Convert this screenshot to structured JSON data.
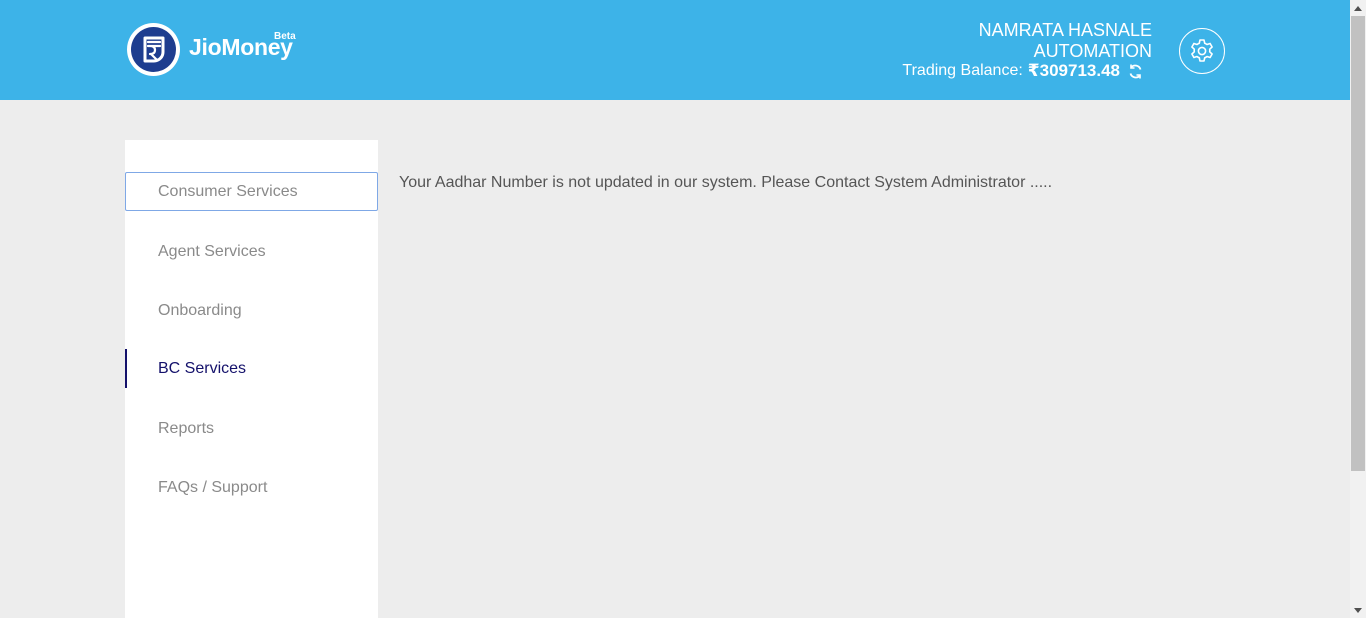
{
  "header": {
    "brand": "JioMoney",
    "beta": "Beta",
    "user_line1": "NAMRATA HASNALE",
    "user_line2": "AUTOMATION",
    "balance_label": "Trading Balance:",
    "balance_amount": "₹309713.48",
    "colors": {
      "bar": "#3db3e8",
      "logo": "#1e3d8f"
    },
    "icons": [
      "rupee-logo-icon",
      "refresh-icon",
      "gear-icon"
    ]
  },
  "sidebar": {
    "items": [
      {
        "label": "Consumer Services",
        "state": "focused"
      },
      {
        "label": "Agent Services",
        "state": "normal"
      },
      {
        "label": "Onboarding",
        "state": "normal"
      },
      {
        "label": "BC Services",
        "state": "active"
      },
      {
        "label": "Reports",
        "state": "normal"
      },
      {
        "label": "FAQs / Support",
        "state": "normal"
      }
    ],
    "active_color": "#14116b"
  },
  "main": {
    "message": "Your Aadhar Number is not updated in our system. Please Contact System Administrator ....."
  }
}
